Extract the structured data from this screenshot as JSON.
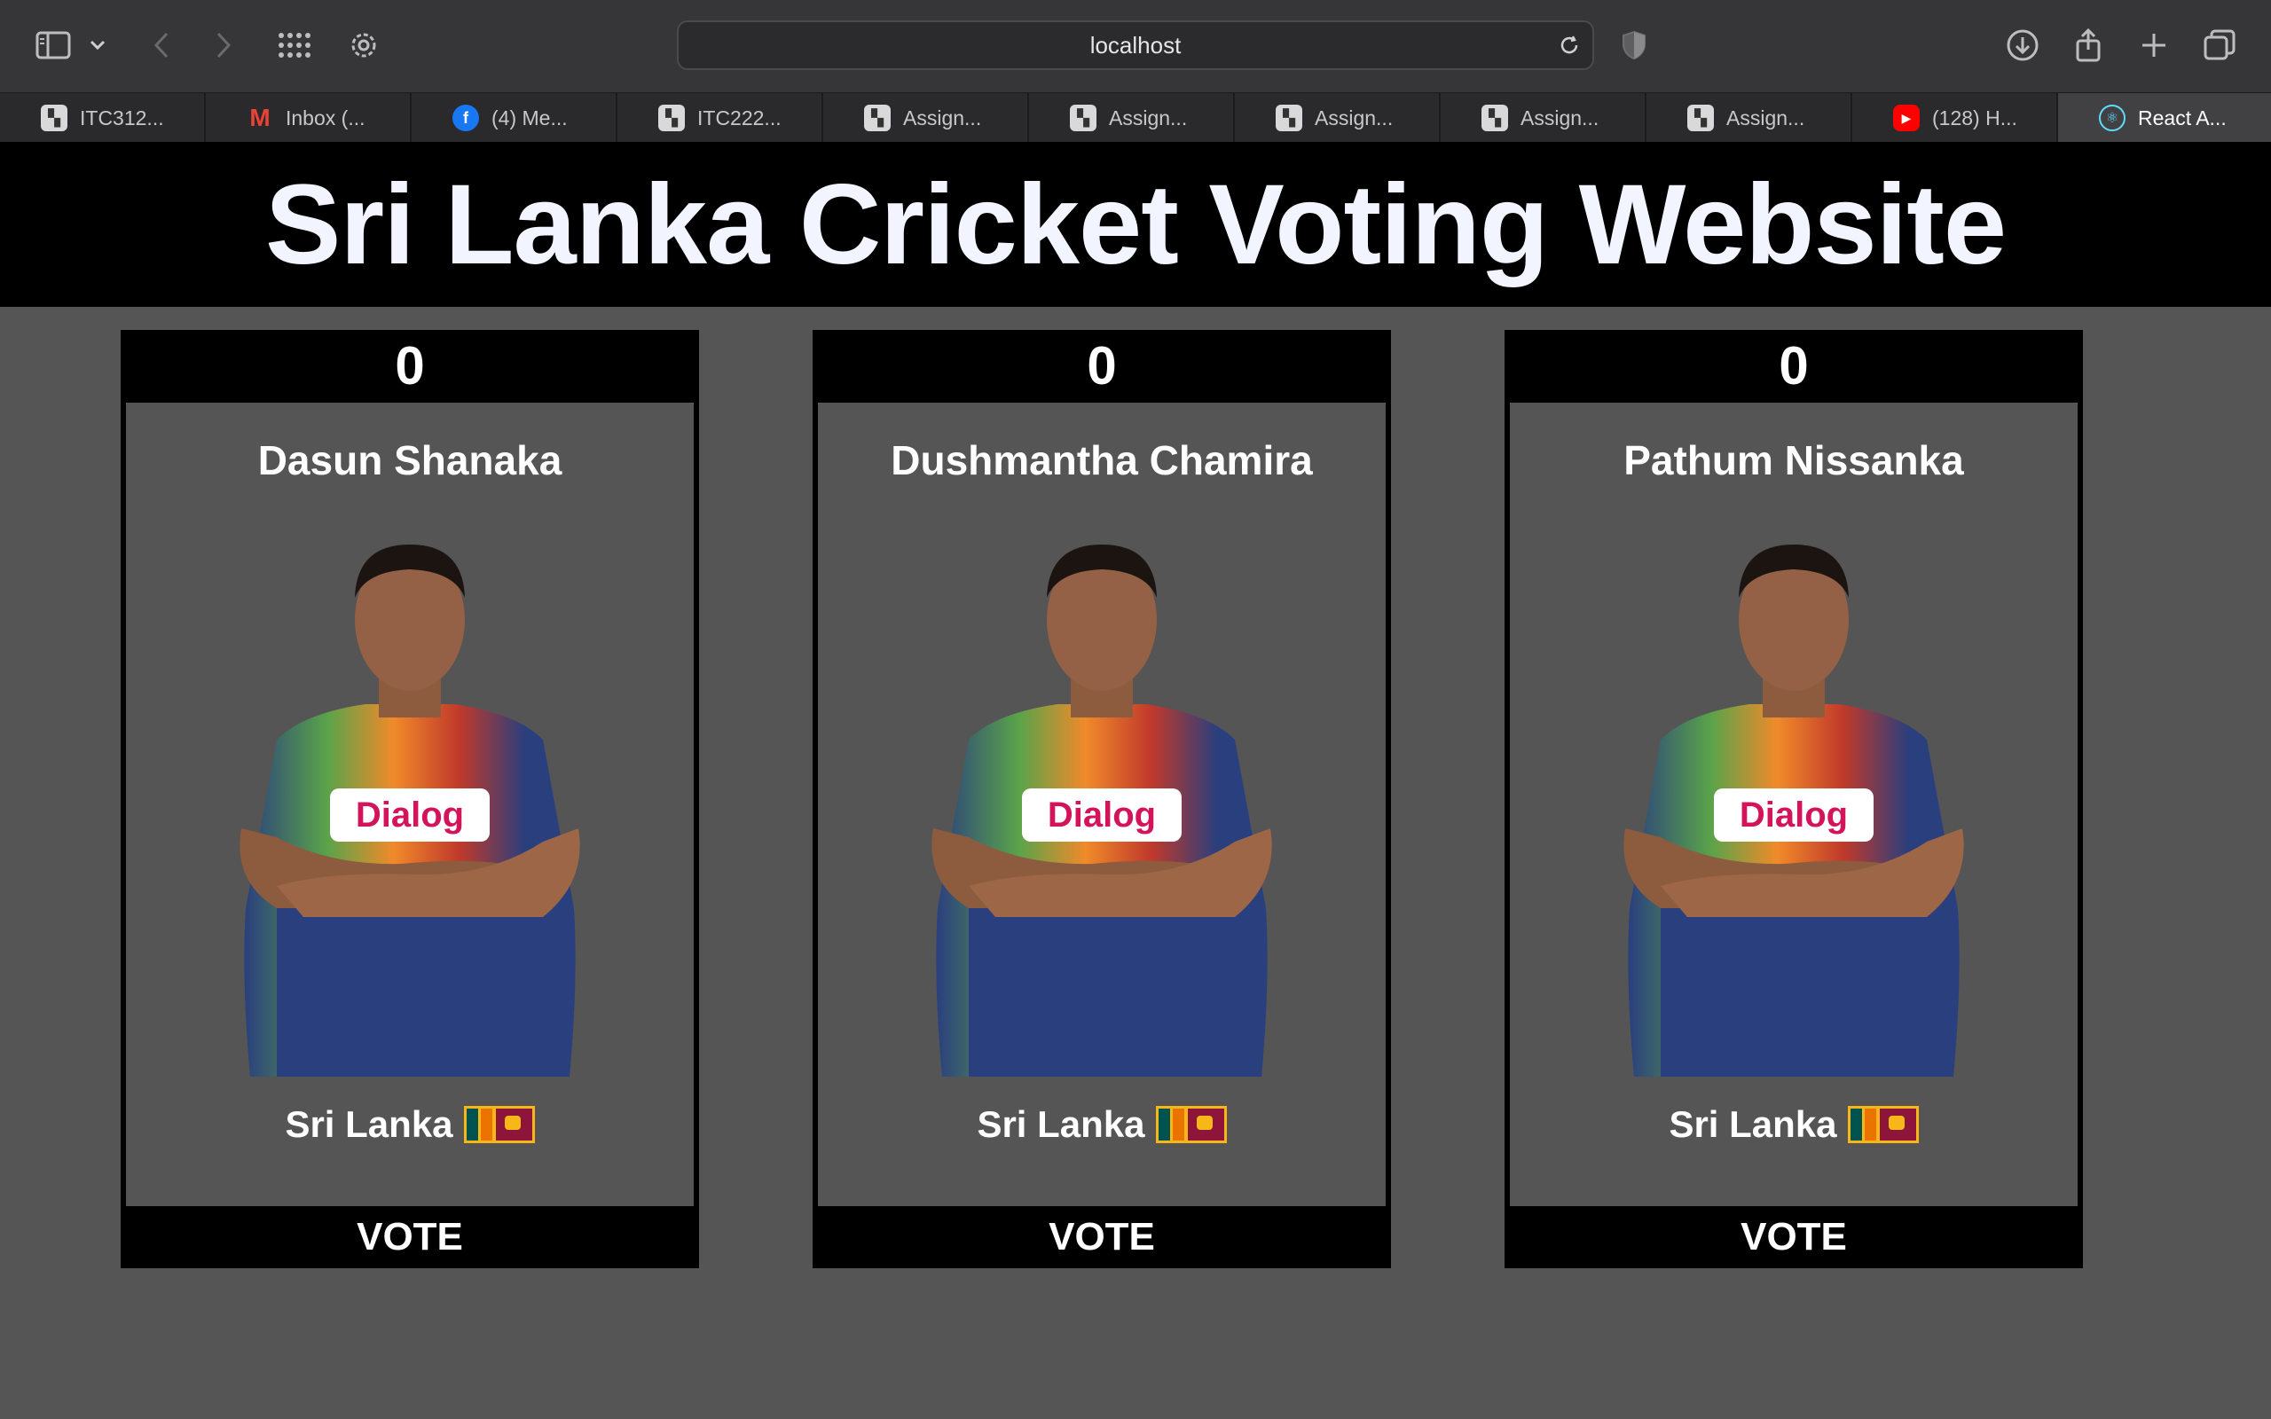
{
  "browser": {
    "address": "localhost",
    "tabs": [
      {
        "label": "ITC312...",
        "icon": "university-icon"
      },
      {
        "label": "Inbox (...",
        "icon": "gmail-icon"
      },
      {
        "label": "(4) Me...",
        "icon": "facebook-icon"
      },
      {
        "label": "ITC222...",
        "icon": "university-icon"
      },
      {
        "label": "Assign...",
        "icon": "university-icon"
      },
      {
        "label": "Assign...",
        "icon": "university-icon"
      },
      {
        "label": "Assign...",
        "icon": "university-icon"
      },
      {
        "label": "Assign...",
        "icon": "university-icon"
      },
      {
        "label": "Assign...",
        "icon": "university-icon"
      },
      {
        "label": "(128) H...",
        "icon": "youtube-icon"
      },
      {
        "label": "React A...",
        "icon": "react-icon",
        "active": true
      }
    ]
  },
  "page": {
    "title": "Sri Lanka Cricket Voting Website",
    "vote_label": "VOTE",
    "players": [
      {
        "name": "Dasun Shanaka",
        "votes": "0",
        "country": "Sri Lanka"
      },
      {
        "name": "Dushmantha Chamira",
        "votes": "0",
        "country": "Sri Lanka"
      },
      {
        "name": "Pathum Nissanka",
        "votes": "0",
        "country": "Sri Lanka"
      }
    ]
  },
  "colors": {
    "page_bg": "#555555",
    "header_bg": "#000000",
    "title_color": "#f2f4ff",
    "jersey_blue": "#2a3f7e"
  }
}
